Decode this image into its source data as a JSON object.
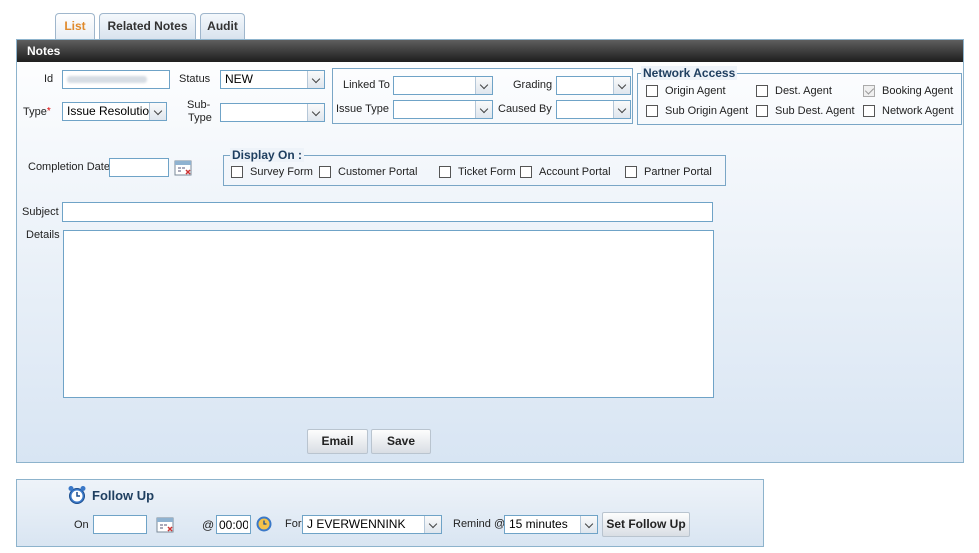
{
  "tabs": [
    {
      "label": "List",
      "active": true
    },
    {
      "label": "Related Notes",
      "active": false
    },
    {
      "label": "Audit",
      "active": false
    }
  ],
  "notes": {
    "header": "Notes",
    "id_label": "Id",
    "status_label": "Status",
    "status_value": "NEW",
    "type_label": "Type",
    "required_mark": "*",
    "type_value": "Issue Resolution",
    "subtype_label_line1": "Sub-",
    "subtype_label_line2": "Type",
    "subtype_value": "",
    "linked_to_label": "Linked To",
    "linked_to_value": "",
    "grading_label": "Grading",
    "grading_value": "",
    "issue_type_label": "Issue Type",
    "issue_type_value": "",
    "caused_by_label": "Caused By",
    "caused_by_value": "",
    "completion_date_label": "Completion Date",
    "completion_date_value": "",
    "subject_label": "Subject",
    "subject_value": "",
    "details_label": "Details",
    "details_value": "",
    "email_button": "Email",
    "save_button": "Save"
  },
  "network_access": {
    "legend": "Network Access",
    "options": [
      {
        "label": "Origin Agent",
        "checked": false
      },
      {
        "label": "Dest. Agent",
        "checked": false
      },
      {
        "label": "Booking Agent",
        "checked": true
      },
      {
        "label": "Sub Origin Agent",
        "checked": false
      },
      {
        "label": "Sub Dest. Agent",
        "checked": false
      },
      {
        "label": "Network Agent",
        "checked": false
      }
    ]
  },
  "display_on": {
    "legend": "Display On :",
    "options": [
      {
        "label": "Survey Form",
        "checked": false
      },
      {
        "label": "Customer Portal",
        "checked": false
      },
      {
        "label": "Ticket Form",
        "checked": false
      },
      {
        "label": "Account Portal",
        "checked": false
      },
      {
        "label": "Partner Portal",
        "checked": false
      }
    ]
  },
  "follow_up": {
    "title": "Follow Up",
    "on_label": "On",
    "on_value": "",
    "at_label": "@",
    "time_value": "00:00",
    "for_label": "For",
    "for_value": "J EVERWENNINK",
    "remind_label": "Remind @",
    "remind_value": "15 minutes",
    "set_button": "Set Follow Up"
  },
  "colors": {
    "accent_tab": "#e08a2c",
    "panel_border": "#8db3cc",
    "header_dark": "#1e1e1e",
    "input_border": "#6fa3c7"
  }
}
